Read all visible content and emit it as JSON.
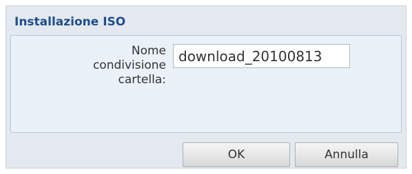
{
  "dialog": {
    "title": "Installazione ISO"
  },
  "form": {
    "share_name": {
      "label_lines": [
        "Nome",
        "condivisione",
        "cartella:"
      ],
      "value": "download_20100813"
    }
  },
  "buttons": {
    "ok_label": "OK",
    "cancel_label": "Annulla"
  }
}
